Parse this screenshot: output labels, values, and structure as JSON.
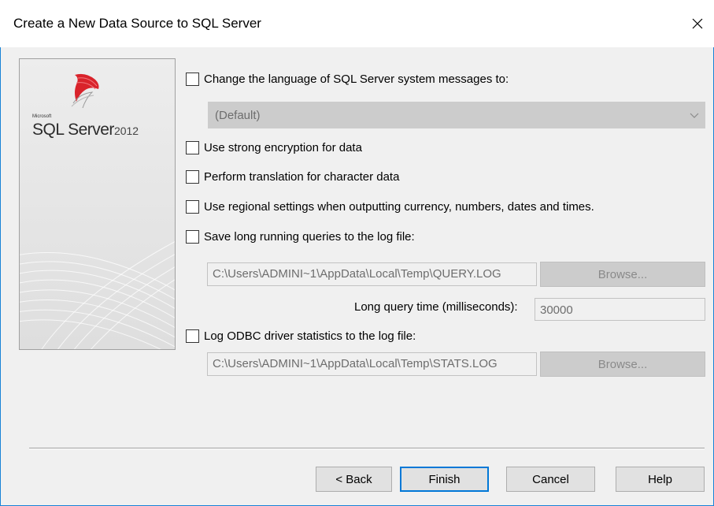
{
  "window": {
    "title": "Create a New Data Source to SQL Server",
    "close_icon": "close-icon"
  },
  "logo": {
    "brand": "Microsoft",
    "product": "SQL Server",
    "version": "2012",
    "colors": {
      "accent": "#d9232b"
    }
  },
  "options": {
    "change_language": {
      "label": "Change the language of SQL Server system messages to:",
      "checked": false
    },
    "language_select": {
      "value": "(Default)"
    },
    "strong_encryption": {
      "label": "Use strong encryption for data",
      "checked": false
    },
    "translation": {
      "label": "Perform translation for character data",
      "checked": false
    },
    "regional_settings": {
      "label": "Use regional settings when outputting currency, numbers, dates and times.",
      "checked": false
    },
    "long_queries": {
      "label": "Save long running queries to the log file:",
      "checked": false,
      "path": "C:\\Users\\ADMINI~1\\AppData\\Local\\Temp\\QUERY.LOG",
      "browse_label": "Browse...",
      "time_label": "Long query time (milliseconds):",
      "time_value": "30000"
    },
    "driver_stats": {
      "label": "Log ODBC driver statistics to the log file:",
      "checked": false,
      "path": "C:\\Users\\ADMINI~1\\AppData\\Local\\Temp\\STATS.LOG",
      "browse_label": "Browse..."
    }
  },
  "buttons": {
    "back": "< Back",
    "finish": "Finish",
    "cancel": "Cancel",
    "help": "Help"
  },
  "colors": {
    "window_border": "#1883d7",
    "default_button_border": "#0078d7",
    "dialog_background": "#f0f0f0"
  }
}
